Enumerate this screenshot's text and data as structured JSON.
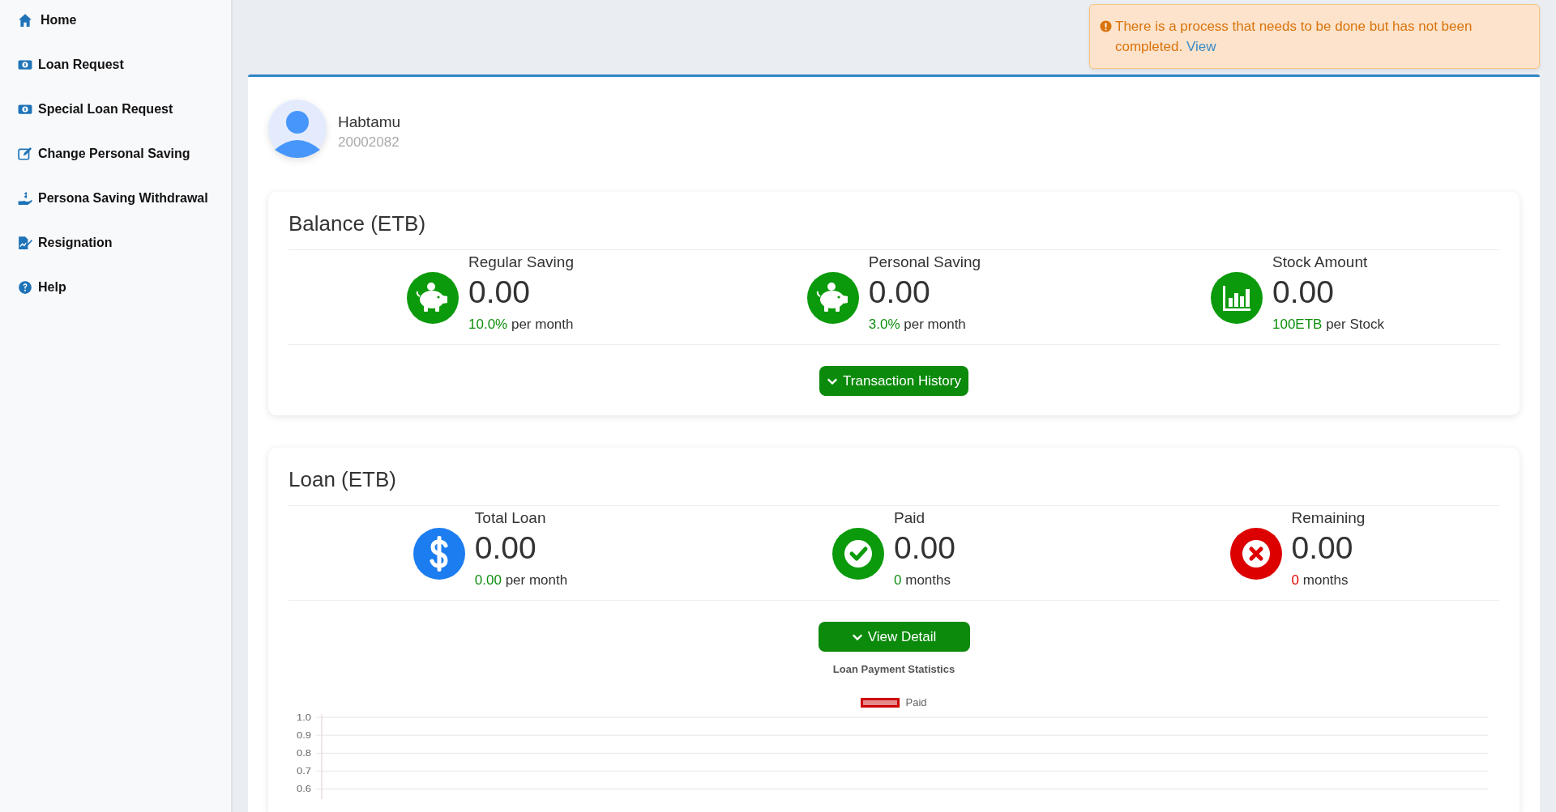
{
  "sidebar": {
    "items": [
      {
        "kind": "home",
        "label": "Home"
      },
      {
        "kind": "money",
        "label": "Loan Request"
      },
      {
        "kind": "money",
        "label": "Special Loan Request"
      },
      {
        "kind": "edit",
        "label": "Change Personal Saving"
      },
      {
        "kind": "hand",
        "label": "Persona Saving Withdrawal"
      },
      {
        "kind": "sign",
        "label": "Resignation"
      },
      {
        "kind": "help",
        "label": "Help"
      }
    ]
  },
  "alert": {
    "message": "There is a process that needs to be done but has not been completed.",
    "link": "View"
  },
  "profile": {
    "name": "Habtamu",
    "id": "20002082"
  },
  "balance": {
    "title": "Balance (ETB)",
    "stats": [
      {
        "kind": "piggy",
        "label": "Regular Saving",
        "value": "0.00",
        "figure": "10.0%",
        "unit": "per month",
        "color": "#0e8f0e"
      },
      {
        "kind": "piggy",
        "label": "Personal Saving",
        "value": "0.00",
        "figure": "3.0%",
        "unit": "per month",
        "color": "#0e8f0e"
      },
      {
        "kind": "chart",
        "label": "Stock Amount",
        "value": "0.00",
        "figure": "100ETB",
        "unit": "per Stock",
        "color": "#0e8f0e"
      }
    ],
    "button": "Transaction History"
  },
  "loan": {
    "title": "Loan (ETB)",
    "stats": [
      {
        "kind": "dollar",
        "label": "Total Loan",
        "value": "0.00",
        "figure": "0.00",
        "unit": "per month",
        "color": "#0e8f0e"
      },
      {
        "kind": "check",
        "label": "Paid",
        "value": "0.00",
        "figure": "0",
        "unit": "months",
        "color": "#0e8f0e"
      },
      {
        "kind": "cross",
        "label": "Remaining",
        "value": "0.00",
        "figure": "0",
        "unit": "months",
        "color": "#e00000"
      }
    ],
    "button": "View Detail",
    "chart_data": {
      "type": "bar",
      "title": "Loan Payment Statistics",
      "grid": true,
      "ylim": [
        0,
        1
      ],
      "series": [
        {
          "name": "Paid",
          "color": "#cc0000"
        }
      ],
      "yticks": [
        {
          "value": 1,
          "label": "1.0"
        },
        {
          "value": 0.9,
          "label": "0.9"
        },
        {
          "value": 0.8,
          "label": "0.8"
        },
        {
          "value": 0.7,
          "label": "0.7"
        },
        {
          "value": 0.6,
          "label": "0.6"
        }
      ]
    }
  }
}
